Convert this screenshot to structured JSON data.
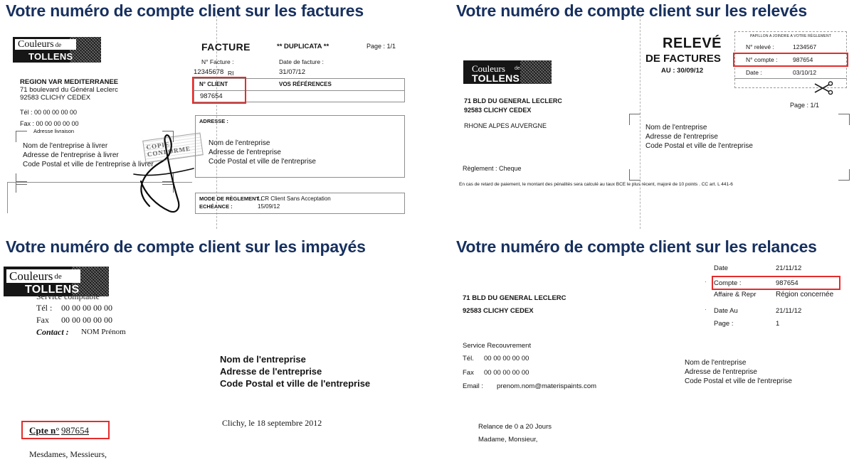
{
  "headings": {
    "factures": "Votre numéro de compte client sur les factures",
    "releves": "Votre numéro de compte client sur les relevés",
    "impayes": "Votre numéro de compte client sur les impayés",
    "relances": "Votre numéro de compte client sur les relances"
  },
  "colors": {
    "heading": "#17305e",
    "highlight_box": "#e03030",
    "logo_bg": "#1b1b1b",
    "page_bg": "#ffffff"
  },
  "logo": {
    "word1": "Couleurs",
    "word2": "de",
    "word3": "TOLLENS"
  },
  "facture": {
    "sender": {
      "line1": "REGION  VAR MEDITERRANEE",
      "line2": "71 boulevard du Général Leclerc",
      "line3": "92583 CLICHY CEDEX",
      "tel": "Tél : 00 00 00 00 00",
      "fax": "Fax : 00 00 00 00 00"
    },
    "delivery": {
      "caption": "Adresse livraison",
      "line1": "Nom de l'entreprise à livrer",
      "line2": "Adresse de l'entreprise à livrer",
      "line3": "Code Postal et ville de l'entreprise à livrer"
    },
    "title": "FACTURE",
    "duplicata": "** DUPLICATA **",
    "page": "Page : 1/1",
    "invoice_label": "N° Facture :",
    "invoice_number": "12345678",
    "invoice_suffix": "RI",
    "date_label": "Date de facture :",
    "date_value": "31/07/12",
    "client_header": "N° CLIENT",
    "client_number": "987654",
    "refs_header": "VOS RÉFÉRENCES",
    "address_label": "ADRESSE :",
    "address": {
      "line1": "Nom de l'entreprise",
      "line2": "Adresse de l'entreprise",
      "line3": "Code Postal et ville de l'entreprise"
    },
    "payment_mode_label": "MODE DE RÈGLEMENT :",
    "payment_mode_value": "LCR Client Sans Acceptation",
    "due_label": "ECHÉANCE :",
    "due_value": "15/09/12",
    "stamp_text": "COPIE CONFORME"
  },
  "releve": {
    "sender": {
      "line1": "71 BLD DU GENERAL LECLERC",
      "line2": "92583 CLICHY CEDEX",
      "region": "RHONE ALPES AUVERGNE"
    },
    "title_line1": "RELEVÉ",
    "title_line2": "DE FACTURES",
    "title_line3": "AU : 30/09/12",
    "slip": {
      "caption": "PAPILLON A JOINDRE A VOTRE RÈGLEMENT",
      "rows": [
        {
          "label": "N° relevé :",
          "value": "1234567",
          "highlight": false
        },
        {
          "label": "N° compte :",
          "value": "987654",
          "highlight": true
        },
        {
          "label": "Date :",
          "value": "03/10/12",
          "highlight": false
        }
      ]
    },
    "page": "Page : 1/1",
    "address": {
      "line1": "Nom de l'entreprise",
      "line2": "Adresse de l'entreprise",
      "line3": "Code Postal et ville de l'entreprise"
    },
    "payment": "Règlement : Cheque",
    "legal": "En cas de retard de paiement, le montant des pénalités sera calculé au taux BCE le plus récent, majoré de 10 points . CC art. L 441-6"
  },
  "impaye": {
    "service": "Service comptable",
    "tel_label": "Tél :",
    "tel_value": "00 00 00 00 00",
    "fax_label": "Fax",
    "fax_value": "00 00 00 00 00",
    "contact_label": "Contact :",
    "contact_value": "NOM Prénom",
    "address": {
      "line1": "Nom de l'entreprise",
      "line2": "Adresse de l'entreprise",
      "line3": "Code Postal et ville de l'entreprise"
    },
    "city_date": "Clichy, le 18 septembre 2012",
    "account_label": "Cpte n°",
    "account_number": "987654",
    "salutation": "Mesdames, Messieurs,"
  },
  "relance": {
    "sender": {
      "line1": "71 BLD DU GENERAL LECLERC",
      "line2": "92583 CLICHY CEDEX"
    },
    "service": "Service Recouvrement",
    "tel_label": "Tél.",
    "tel_value": "00 00 00 00 00",
    "fax_label": "Fax",
    "fax_value": "00 00 00 00 00",
    "email_label": "Email :",
    "email_value": "prenom.nom@materispaints.com",
    "info_rows": [
      {
        "label": "Date",
        "value": "21/11/12",
        "highlight": false
      },
      {
        "label": "Compte :",
        "value": "987654",
        "highlight": true
      },
      {
        "label": "Affaire & Repr",
        "value": "Région concernée",
        "highlight": false
      },
      {
        "label": "Date Au",
        "value": "21/11/12",
        "highlight": false
      },
      {
        "label": "Page :",
        "value": "1",
        "highlight": false
      }
    ],
    "address": {
      "line1": "Nom de l'entreprise",
      "line2": "Adresse de l'entreprise",
      "line3": "Code Postal et ville de l'entreprise"
    },
    "relance_line": "Relance de 0 a 20 Jours",
    "salutation": "Madame, Monsieur,"
  }
}
